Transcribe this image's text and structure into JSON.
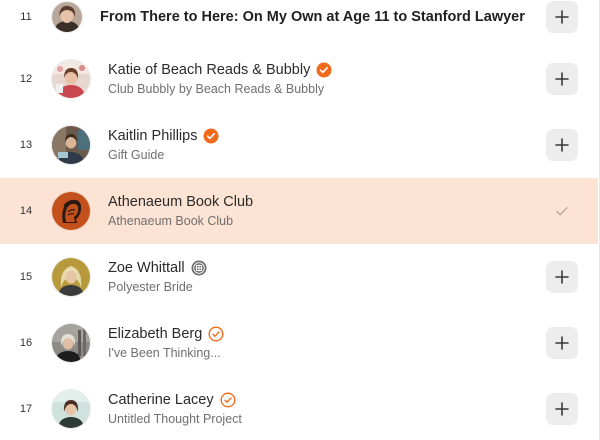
{
  "colors": {
    "accent": "#f26b1d",
    "selected_row_bg": "#fde3d3",
    "button_bg": "#ededed"
  },
  "rows": [
    {
      "rank": "11",
      "name": "From There to Here: On My Own at Age 11 to Stanford Lawyer",
      "subtitle": "",
      "badge": "",
      "state": "add"
    },
    {
      "rank": "12",
      "name": "Katie of Beach Reads & Bubbly",
      "subtitle": "Club Bubbly by Beach Reads & Bubbly",
      "badge": "verified-filled-icon",
      "state": "add"
    },
    {
      "rank": "13",
      "name": "Kaitlin Phillips",
      "subtitle": "Gift Guide",
      "badge": "verified-filled-icon",
      "state": "add"
    },
    {
      "rank": "14",
      "name": "Athenaeum Book Club",
      "subtitle": "Athenaeum Book Club",
      "badge": "",
      "state": "subscribed"
    },
    {
      "rank": "15",
      "name": "Zoe Whittall",
      "subtitle": "Polyester Bride",
      "badge": "gray-emblem-icon",
      "state": "add"
    },
    {
      "rank": "16",
      "name": "Elizabeth Berg",
      "subtitle": "I've Been Thinking...",
      "badge": "verified-outline-icon",
      "state": "add"
    },
    {
      "rank": "17",
      "name": "Catherine Lacey",
      "subtitle": "Untitled Thought Project",
      "badge": "verified-outline-icon",
      "state": "add"
    }
  ]
}
